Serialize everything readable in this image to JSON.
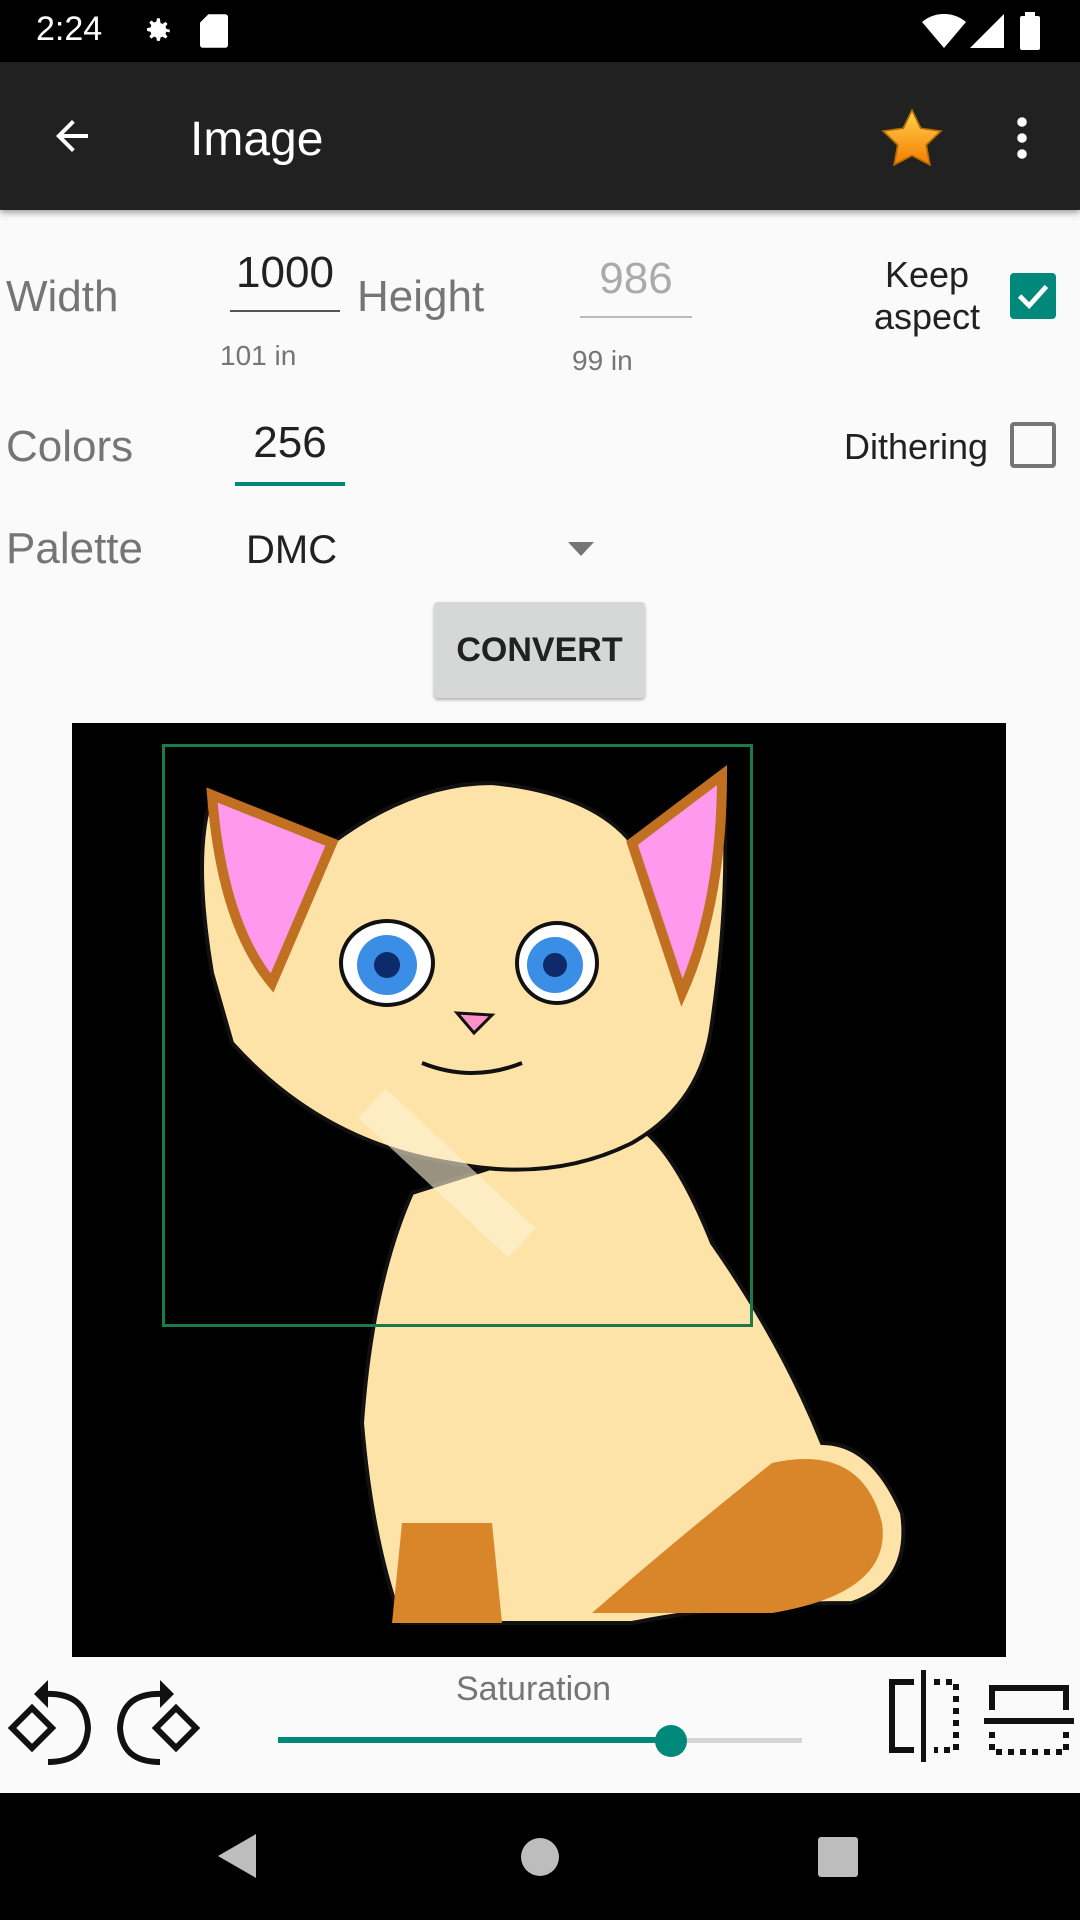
{
  "status_bar": {
    "time": "2:24",
    "icons": [
      "gear-icon",
      "sd-card-icon",
      "wifi-icon",
      "signal-icon",
      "battery-icon"
    ]
  },
  "app_bar": {
    "title": "Image",
    "icons": [
      "back-arrow-icon",
      "star-icon",
      "more-vert-icon"
    ]
  },
  "form": {
    "width_label": "Width",
    "width_value": "1000",
    "width_inches": "101 in",
    "height_label": "Height",
    "height_value": "986",
    "height_inches": "99 in",
    "keep_aspect_label": "Keep aspect",
    "keep_aspect_checked": true,
    "colors_label": "Colors",
    "colors_value": "256",
    "dithering_label": "Dithering",
    "dithering_checked": false,
    "palette_label": "Palette",
    "palette_value": "DMC",
    "convert_label": "CONVERT"
  },
  "controls": {
    "saturation_label": "Saturation",
    "saturation_value": 0.75,
    "icons": [
      "rotate-left-icon",
      "rotate-right-icon",
      "flip-horizontal-icon",
      "flip-vertical-icon"
    ]
  },
  "colors": {
    "accent": "#00897b",
    "crop_rect": "#1b7a4a"
  }
}
